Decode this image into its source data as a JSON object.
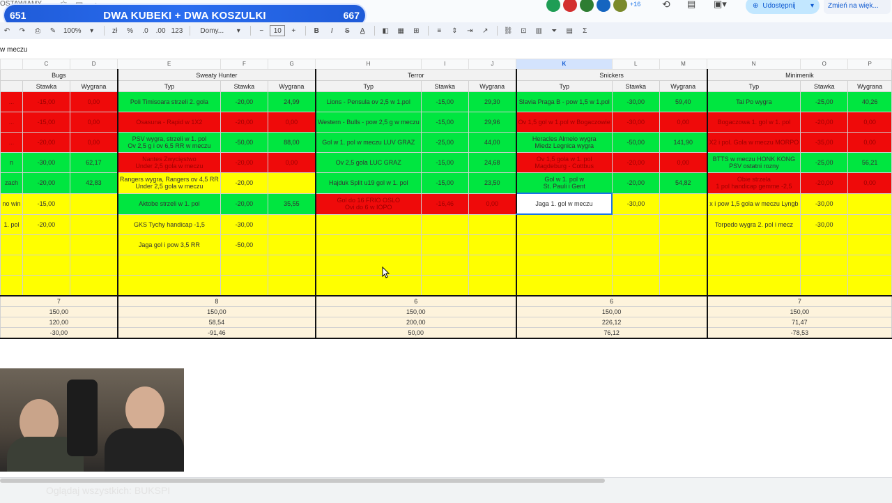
{
  "app": {
    "doc_title_fragment": "OSTAWIAMY",
    "share_label": "Udostępnij",
    "change_label": "Zmień na więk...",
    "collab_count": "+16"
  },
  "banner": {
    "left_count": "651",
    "title": "DWA KUBEKI + DWA KOSZULKI",
    "right_count": "667"
  },
  "toolbar": {
    "zoom": "100%",
    "font": "Domy...",
    "font_size": "10",
    "percent": "%",
    "dec_less": ".0",
    "dec_more": ".00",
    "num123": "123",
    "currency": "zł",
    "minus": "−",
    "plus": "+",
    "bold": "B",
    "italic": "I",
    "strike": "S",
    "text_a": "A",
    "sigma": "Σ"
  },
  "formula": {
    "value": "w meczu"
  },
  "columns": [
    "",
    "C",
    "D",
    "E",
    "F",
    "G",
    "H",
    "I",
    "J",
    "K",
    "L",
    "M",
    "N",
    "O",
    "P"
  ],
  "groups": {
    "bugs": "Bugs",
    "sweaty": "Sweaty Hunter",
    "terror": "Terror",
    "snickers": "Snickers",
    "minimenik": "Minimenik"
  },
  "sub": {
    "typ": "Typ",
    "stawka": "Stawka",
    "wygrana": "Wygrana"
  },
  "rows": [
    [
      {
        "t": "...",
        "c": "r"
      },
      {
        "t": "-15,00",
        "c": "r"
      },
      {
        "t": "0,00",
        "c": "r"
      },
      {
        "t": "Poli Timisoara strzeli 2. gola",
        "c": "g"
      },
      {
        "t": "-20,00",
        "c": "g"
      },
      {
        "t": "24,99",
        "c": "g"
      },
      {
        "t": "Lions - Pensula ov 2,5 w 1.pol",
        "c": "g"
      },
      {
        "t": "-15,00",
        "c": "g"
      },
      {
        "t": "29,30",
        "c": "g"
      },
      {
        "t": "Slavia Praga B - pow 1,5 w 1.pol",
        "c": "g"
      },
      {
        "t": "-30,00",
        "c": "g"
      },
      {
        "t": "59,40",
        "c": "g"
      },
      {
        "t": "Tai Po wygra",
        "c": "g"
      },
      {
        "t": "-25,00",
        "c": "g"
      },
      {
        "t": "40,26",
        "c": "g"
      }
    ],
    [
      {
        "t": "...",
        "c": "r"
      },
      {
        "t": "-15,00",
        "c": "r"
      },
      {
        "t": "0,00",
        "c": "r"
      },
      {
        "t": "Osasuna - Rapid w 1X2",
        "c": "r"
      },
      {
        "t": "-20,00",
        "c": "r"
      },
      {
        "t": "0,00",
        "c": "r"
      },
      {
        "t": "Western - Bulls - pow 2,5 g w meczu",
        "c": "g"
      },
      {
        "t": "-15,00",
        "c": "g"
      },
      {
        "t": "29,96",
        "c": "g"
      },
      {
        "t": "Ov 1,5 gol w 1.pol w Bogaczowie",
        "c": "r"
      },
      {
        "t": "-30,00",
        "c": "r"
      },
      {
        "t": "0,00",
        "c": "r"
      },
      {
        "t": "Bogaczowa 1. gol w 1. pol",
        "c": "r"
      },
      {
        "t": "-20,00",
        "c": "r"
      },
      {
        "t": "0,00",
        "c": "r"
      }
    ],
    [
      {
        "t": "...",
        "c": "r"
      },
      {
        "t": "-20,00",
        "c": "r"
      },
      {
        "t": "0,00",
        "c": "r"
      },
      {
        "t": "PSV wygra, strzeli w 1. pol\nOv 2,5 g i ov 6,5 RR w meczu",
        "c": "g"
      },
      {
        "t": "-50,00",
        "c": "g"
      },
      {
        "t": "88,00",
        "c": "g"
      },
      {
        "t": "Gol w 1. pol w meczu LUV GRAZ",
        "c": "g"
      },
      {
        "t": "-25,00",
        "c": "g"
      },
      {
        "t": "44,00",
        "c": "g"
      },
      {
        "t": "Heracles Almelo wygra\nMiedz Legnica wygra",
        "c": "g"
      },
      {
        "t": "-50,00",
        "c": "g"
      },
      {
        "t": "141,90",
        "c": "g"
      },
      {
        "t": "X2 i pol. Gola w meczu MORPO",
        "c": "r"
      },
      {
        "t": "-35,00",
        "c": "r"
      },
      {
        "t": "0,00",
        "c": "r"
      }
    ],
    [
      {
        "t": "n",
        "c": "g"
      },
      {
        "t": "-30,00",
        "c": "g"
      },
      {
        "t": "62,17",
        "c": "g"
      },
      {
        "t": "Nantes Zwycięstwo\nUnder 2,5 gola w meczu",
        "c": "r"
      },
      {
        "t": "-20,00",
        "c": "r"
      },
      {
        "t": "0,00",
        "c": "r"
      },
      {
        "t": "Ov 2,5 gola LUC GRAZ",
        "c": "g"
      },
      {
        "t": "-15,00",
        "c": "g"
      },
      {
        "t": "24,68",
        "c": "g"
      },
      {
        "t": "Ov 1,5 gola w 1. pol\nMagdeburg - Cottbus",
        "c": "r"
      },
      {
        "t": "-20,00",
        "c": "r"
      },
      {
        "t": "0,00",
        "c": "r"
      },
      {
        "t": "BTTS w meczu HONK KONG\nPSV ostatni rozny",
        "c": "g"
      },
      {
        "t": "-25,00",
        "c": "g"
      },
      {
        "t": "56,21",
        "c": "g"
      }
    ],
    [
      {
        "t": "zach",
        "c": "g"
      },
      {
        "t": "-20,00",
        "c": "g"
      },
      {
        "t": "42,83",
        "c": "g"
      },
      {
        "t": "Rangers wygra, Rangers ov 4,5 RR\nUnder 2,5 gola w meczu",
        "c": "y"
      },
      {
        "t": "-20,00",
        "c": "y"
      },
      {
        "t": "",
        "c": "y"
      },
      {
        "t": "Hajduk Split u19 gol w 1. pol",
        "c": "g"
      },
      {
        "t": "-15,00",
        "c": "g"
      },
      {
        "t": "23,50",
        "c": "g"
      },
      {
        "t": "Gol w 1. pol w\nSt. Pauli i Gent",
        "c": "g"
      },
      {
        "t": "-20,00",
        "c": "g"
      },
      {
        "t": "54,82",
        "c": "g"
      },
      {
        "t": "Obie strzela\n1 pol handicap gemme -2,5",
        "c": "r"
      },
      {
        "t": "-20,00",
        "c": "r"
      },
      {
        "t": "0,00",
        "c": "r"
      }
    ],
    [
      {
        "t": "no win",
        "c": "y"
      },
      {
        "t": "-15,00",
        "c": "y"
      },
      {
        "t": "",
        "c": "y"
      },
      {
        "t": "Aktobe strzeli w 1. pol",
        "c": "g"
      },
      {
        "t": "-20,00",
        "c": "g"
      },
      {
        "t": "35,55",
        "c": "g"
      },
      {
        "t": "Gol do 16 FRIO OSLO\nOvi do 6 w IOPO",
        "c": "r"
      },
      {
        "t": "-16,46",
        "c": "r"
      },
      {
        "t": "0,00",
        "c": "r"
      },
      {
        "t": "Jaga 1. gol w meczu",
        "c": "w"
      },
      {
        "t": "-30,00",
        "c": "y"
      },
      {
        "t": "",
        "c": "y"
      },
      {
        "t": "x i pow 1,5 gola w meczu Lyngb",
        "c": "y"
      },
      {
        "t": "-30,00",
        "c": "y"
      },
      {
        "t": "",
        "c": "y"
      }
    ],
    [
      {
        "t": "1. pol",
        "c": "y"
      },
      {
        "t": "-20,00",
        "c": "y"
      },
      {
        "t": "",
        "c": "y"
      },
      {
        "t": "GKS Tychy handicap -1,5",
        "c": "y"
      },
      {
        "t": "-30,00",
        "c": "y"
      },
      {
        "t": "",
        "c": "y"
      },
      {
        "t": "",
        "c": "y"
      },
      {
        "t": "",
        "c": "y"
      },
      {
        "t": "",
        "c": "y"
      },
      {
        "t": "",
        "c": "y"
      },
      {
        "t": "",
        "c": "y"
      },
      {
        "t": "",
        "c": "y"
      },
      {
        "t": "Torpedo wygra 2. pol i mecz",
        "c": "y"
      },
      {
        "t": "-30,00",
        "c": "y"
      },
      {
        "t": "",
        "c": "y"
      }
    ],
    [
      {
        "t": "",
        "c": "y"
      },
      {
        "t": "",
        "c": "y"
      },
      {
        "t": "",
        "c": "y"
      },
      {
        "t": "Jaga gol i pow 3,5 RR",
        "c": "y"
      },
      {
        "t": "-50,00",
        "c": "y"
      },
      {
        "t": "",
        "c": "y"
      },
      {
        "t": "",
        "c": "y"
      },
      {
        "t": "",
        "c": "y"
      },
      {
        "t": "",
        "c": "y"
      },
      {
        "t": "",
        "c": "y"
      },
      {
        "t": "",
        "c": "y"
      },
      {
        "t": "",
        "c": "y"
      },
      {
        "t": "",
        "c": "y"
      },
      {
        "t": "",
        "c": "y"
      },
      {
        "t": "",
        "c": "y"
      }
    ],
    [
      {
        "t": "",
        "c": "y"
      },
      {
        "t": "",
        "c": "y"
      },
      {
        "t": "",
        "c": "y"
      },
      {
        "t": "",
        "c": "y"
      },
      {
        "t": "",
        "c": "y"
      },
      {
        "t": "",
        "c": "y"
      },
      {
        "t": "",
        "c": "y"
      },
      {
        "t": "",
        "c": "y"
      },
      {
        "t": "",
        "c": "y"
      },
      {
        "t": "",
        "c": "y"
      },
      {
        "t": "",
        "c": "y"
      },
      {
        "t": "",
        "c": "y"
      },
      {
        "t": "",
        "c": "y"
      },
      {
        "t": "",
        "c": "y"
      },
      {
        "t": "",
        "c": "y"
      }
    ],
    [
      {
        "t": "",
        "c": "y"
      },
      {
        "t": "",
        "c": "y"
      },
      {
        "t": "",
        "c": "y"
      },
      {
        "t": "",
        "c": "y"
      },
      {
        "t": "",
        "c": "y"
      },
      {
        "t": "",
        "c": "y"
      },
      {
        "t": "",
        "c": "y"
      },
      {
        "t": "",
        "c": "y"
      },
      {
        "t": "",
        "c": "y"
      },
      {
        "t": "",
        "c": "y"
      },
      {
        "t": "",
        "c": "y"
      },
      {
        "t": "",
        "c": "y"
      },
      {
        "t": "",
        "c": "y"
      },
      {
        "t": "",
        "c": "y"
      },
      {
        "t": "",
        "c": "y"
      }
    ]
  ],
  "summary": [
    {
      "bugs": "7",
      "sweaty": "8",
      "terror": "6",
      "snickers": "6",
      "minimenik": "7"
    },
    {
      "bugs": "150,00",
      "sweaty": "150,00",
      "terror": "150,00",
      "snickers": "150,00",
      "minimenik": "150,00"
    },
    {
      "bugs": "120,00",
      "sweaty": "58,54",
      "terror": "200,00",
      "snickers": "226,12",
      "minimenik": "71,47"
    },
    {
      "bugs": "-30,00",
      "sweaty": "-91,46",
      "terror": "50,00",
      "snickers": "76,12",
      "minimenik": "-78,53"
    }
  ],
  "bottom": {
    "watermark": "Oglądaj wszystkich: BUKSPI"
  }
}
